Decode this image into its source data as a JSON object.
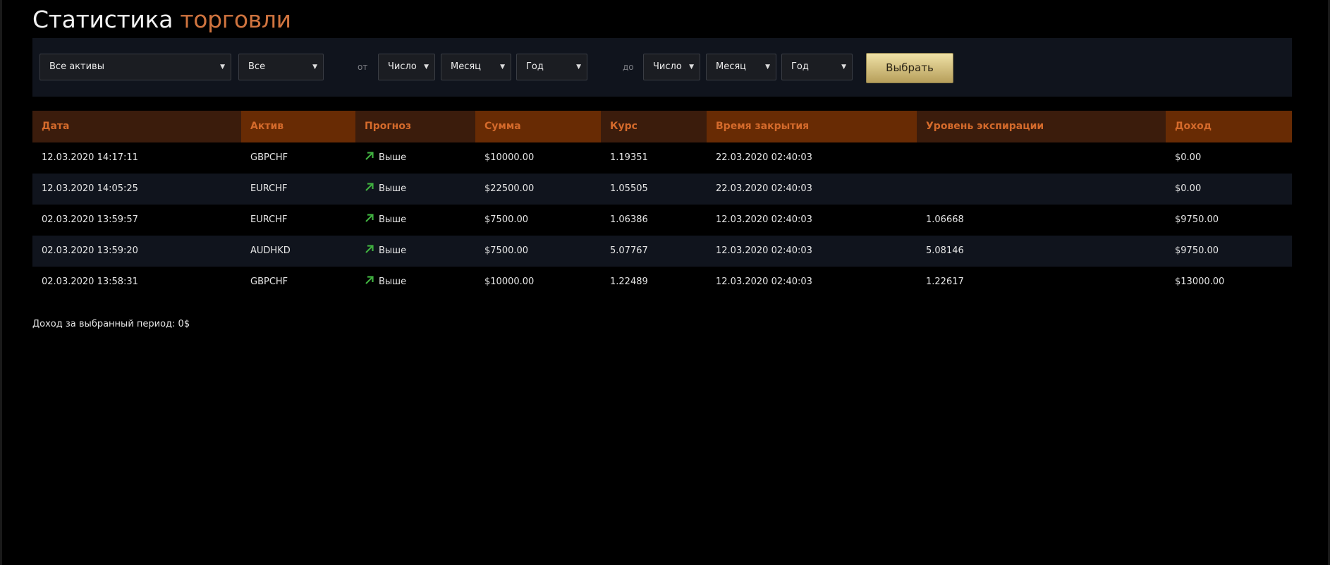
{
  "title": {
    "part1": "Статистика",
    "part2": "торговли"
  },
  "filters": {
    "asset": "Все активы",
    "type": "Все",
    "from_label": "от",
    "from_day": "Число",
    "from_month": "Месяц",
    "from_year": "Год",
    "to_label": "до",
    "to_day": "Число",
    "to_month": "Месяц",
    "to_year": "Год",
    "submit_label": "Выбрать"
  },
  "table": {
    "columns": [
      "Дата",
      "Актив",
      "Прогноз",
      "Сумма",
      "Курс",
      "Время закрытия",
      "Уровень экспирации",
      "Доход"
    ],
    "rows": [
      [
        "12.03.2020 14:17:11",
        "GBPCHF",
        "Выше",
        "$10000.00",
        "1.19351",
        "22.03.2020 02:40:03",
        "",
        "$0.00"
      ],
      [
        "12.03.2020 14:05:25",
        "EURCHF",
        "Выше",
        "$22500.00",
        "1.05505",
        "22.03.2020 02:40:03",
        "",
        "$0.00"
      ],
      [
        "02.03.2020 13:59:57",
        "EURCHF",
        "Выше",
        "$7500.00",
        "1.06386",
        "12.03.2020 02:40:03",
        "1.06668",
        "$9750.00"
      ],
      [
        "02.03.2020 13:59:20",
        "AUDHKD",
        "Выше",
        "$7500.00",
        "5.07767",
        "12.03.2020 02:40:03",
        "5.08146",
        "$9750.00"
      ],
      [
        "02.03.2020 13:58:31",
        "GBPCHF",
        "Выше",
        "$10000.00",
        "1.22489",
        "12.03.2020 02:40:03",
        "1.22617",
        "$13000.00"
      ]
    ]
  },
  "summary": "Доход за выбранный период: 0$",
  "icons": {
    "forecast_up": "arrow-up-right-icon",
    "dropdown": "triangle-down-icon"
  },
  "colors": {
    "accent": "#d0743f",
    "header_text": "#d46a2b",
    "header_dark": "#3b1c0c",
    "header_light": "#682b04",
    "up_arrow": "#3fae3f",
    "button_top": "#efe1a6",
    "button_bottom": "#b79f5b"
  }
}
